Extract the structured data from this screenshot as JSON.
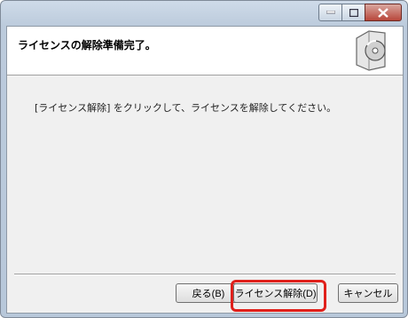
{
  "header": {
    "title": "ライセンスの解除準備完了。"
  },
  "body": {
    "instruction": "[ライセンス解除] をクリックして、ライセンスを解除してください。"
  },
  "buttons": {
    "back": "戻る(B)",
    "uninstall": "ライセンス解除(D)",
    "cancel": "キャンセル"
  },
  "icons": [
    "minimize-icon",
    "maximize-icon",
    "close-icon",
    "disc-installer-icon"
  ],
  "colors": {
    "highlight": "#e0201b",
    "close": "#b8463a"
  }
}
